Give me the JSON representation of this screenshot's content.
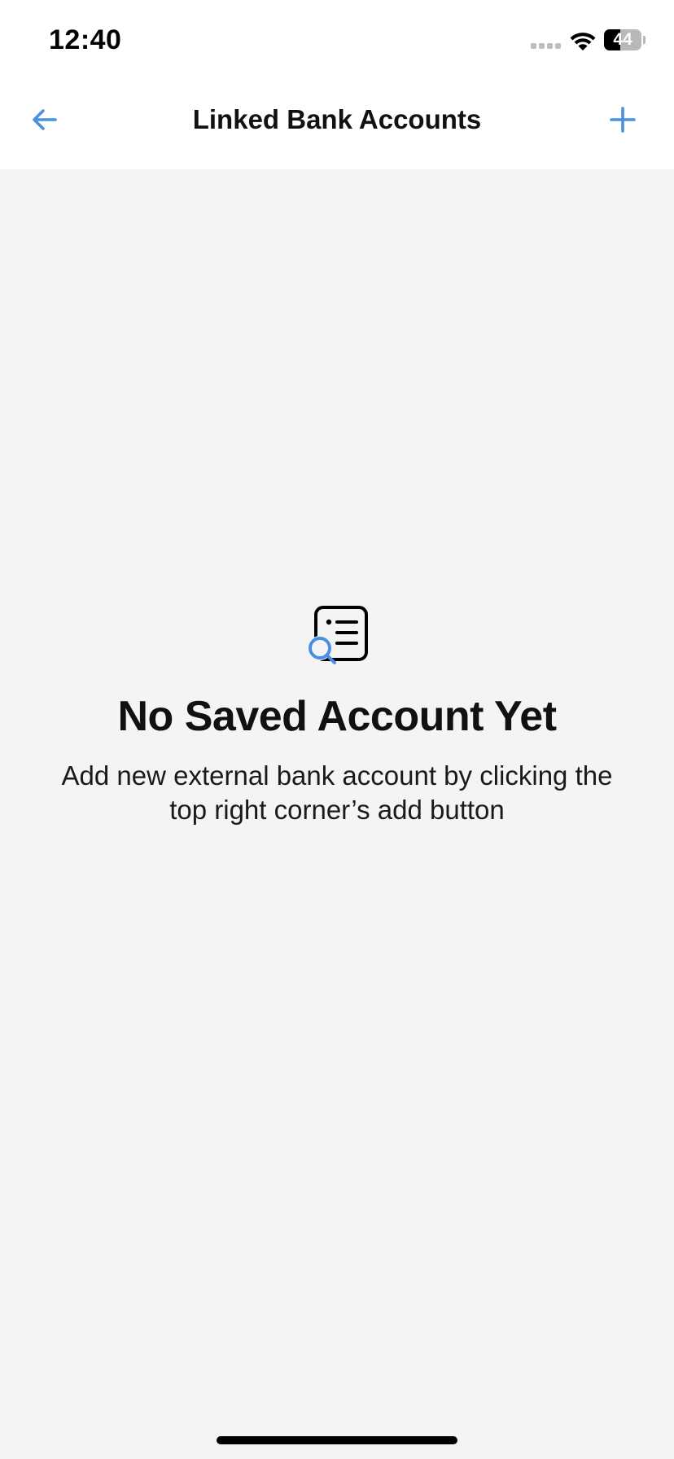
{
  "status_bar": {
    "time": "12:40",
    "battery_level": "44",
    "battery_fraction": 0.44
  },
  "nav": {
    "title": "Linked Bank Accounts",
    "back_icon": "arrow-left-icon",
    "add_icon": "plus-icon"
  },
  "empty_state": {
    "icon": "document-search-icon",
    "title": "No Saved Account Yet",
    "description": "Add new external bank account by clicking the top right corner’s add button"
  },
  "colors": {
    "accent": "#4a90e2",
    "background": "#f4f4f4",
    "header_background": "#ffffff",
    "text": "#111111"
  }
}
